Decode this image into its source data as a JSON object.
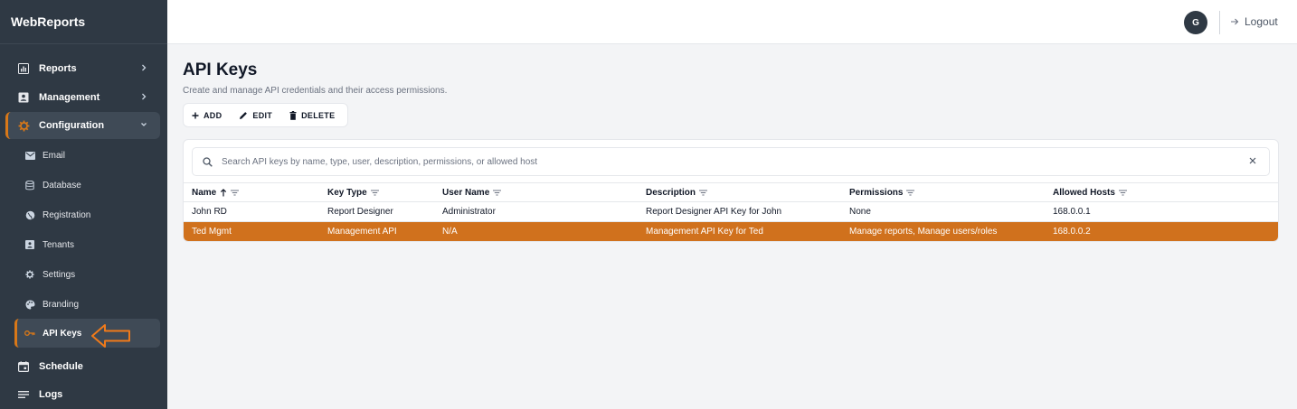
{
  "app": {
    "brand": "WebReports"
  },
  "sidebar": {
    "items": [
      {
        "label": "Reports",
        "icon": "chart-icon"
      },
      {
        "label": "Management",
        "icon": "id-card-icon"
      },
      {
        "label": "Configuration",
        "icon": "gear-icon",
        "expanded": true
      },
      {
        "label": "Schedule",
        "icon": "calendar-icon"
      },
      {
        "label": "Logs",
        "icon": "list-icon"
      }
    ],
    "config_sub": [
      {
        "label": "Email",
        "icon": "email-icon"
      },
      {
        "label": "Database",
        "icon": "database-icon"
      },
      {
        "label": "Registration",
        "icon": "globe-icon"
      },
      {
        "label": "Tenants",
        "icon": "badge-icon"
      },
      {
        "label": "Settings",
        "icon": "gear-icon"
      },
      {
        "label": "Branding",
        "icon": "palette-icon"
      },
      {
        "label": "API Keys",
        "icon": "key-icon",
        "active": true
      }
    ]
  },
  "header": {
    "avatar_initial": "G",
    "logout_label": "Logout"
  },
  "main": {
    "title": "API Keys",
    "subtitle": "Create and manage API credentials and their access permissions.",
    "toolbar": {
      "add": "ADD",
      "edit": "EDIT",
      "delete": "DELETE"
    },
    "search": {
      "placeholder": "Search API keys by name, type, user, description, permissions, or allowed host",
      "value": ""
    },
    "columns": [
      "Name",
      "Key Type",
      "User Name",
      "Description",
      "Permissions",
      "Allowed Hosts"
    ],
    "rows": [
      {
        "name": "John RD",
        "key_type": "Report Designer",
        "user": "Administrator",
        "description": "Report Designer API Key for John",
        "permissions": "None",
        "hosts": "168.0.0.1"
      },
      {
        "name": "Ted Mgmt",
        "key_type": "Management API",
        "user": "N/A",
        "description": "Management API Key for Ted",
        "permissions": "Manage reports, Manage users/roles",
        "hosts": "168.0.0.2",
        "selected": true
      }
    ]
  },
  "colors": {
    "accent": "#d0711d",
    "sidebar_bg": "#2f3944",
    "arrow": "#f07a1a"
  }
}
